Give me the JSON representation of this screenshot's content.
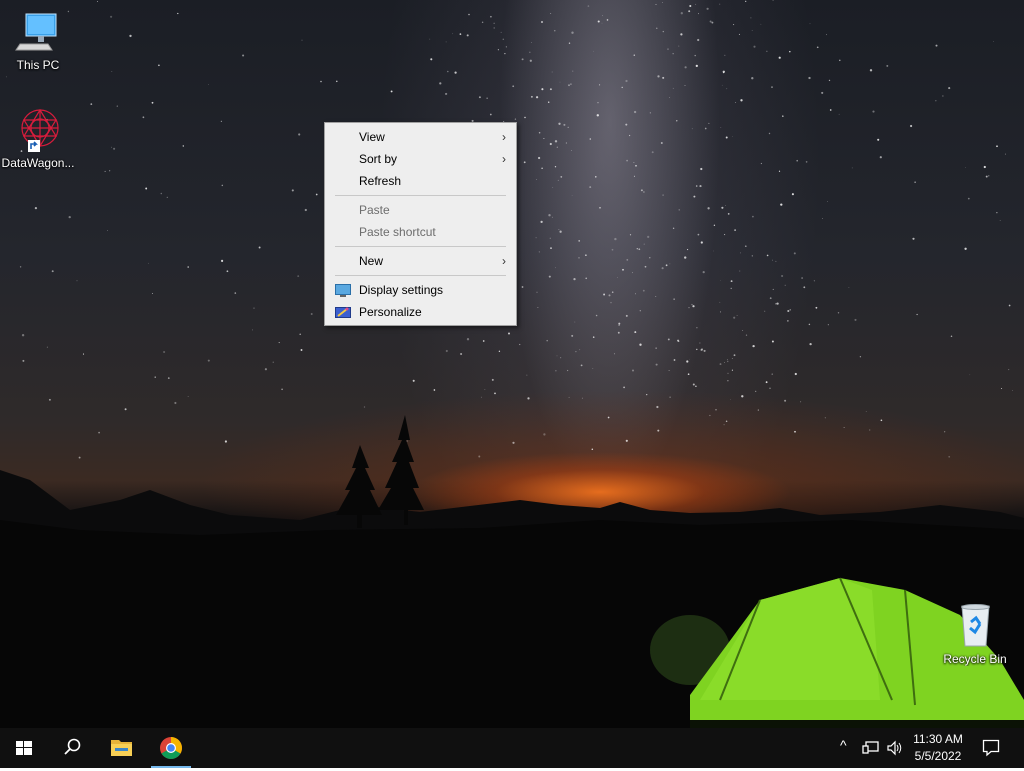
{
  "desktop": {
    "icons": [
      {
        "label": "This PC",
        "icon": "computer-icon"
      },
      {
        "label": "DataWagon...",
        "icon": "datawagon-icon"
      },
      {
        "label": "Recycle Bin",
        "icon": "recycle-bin-icon"
      }
    ]
  },
  "context_menu": {
    "items": [
      {
        "label": "View",
        "submenu": true
      },
      {
        "label": "Sort by",
        "submenu": true
      },
      {
        "label": "Refresh"
      },
      {
        "label": "Paste",
        "disabled": true
      },
      {
        "label": "Paste shortcut",
        "disabled": true
      },
      {
        "label": "New",
        "submenu": true
      },
      {
        "label": "Display settings",
        "icon": "display-icon"
      },
      {
        "label": "Personalize",
        "icon": "personalize-icon"
      }
    ],
    "submenu_glyph": "›"
  },
  "taskbar": {
    "buttons": [
      {
        "name": "start",
        "icon": "windows-icon"
      },
      {
        "name": "search",
        "icon": "search-icon"
      },
      {
        "name": "file-explorer",
        "icon": "folder-icon"
      },
      {
        "name": "chrome",
        "icon": "chrome-icon",
        "active": true
      }
    ],
    "tray": {
      "chevron": "^",
      "clock_time": "11:30 AM",
      "clock_date": "5/5/2022"
    }
  },
  "colors": {
    "taskbar": "#101010",
    "menu_bg": "#eeeeee",
    "active_indicator": "#76b9ed",
    "tent_green": "#7fd321"
  }
}
